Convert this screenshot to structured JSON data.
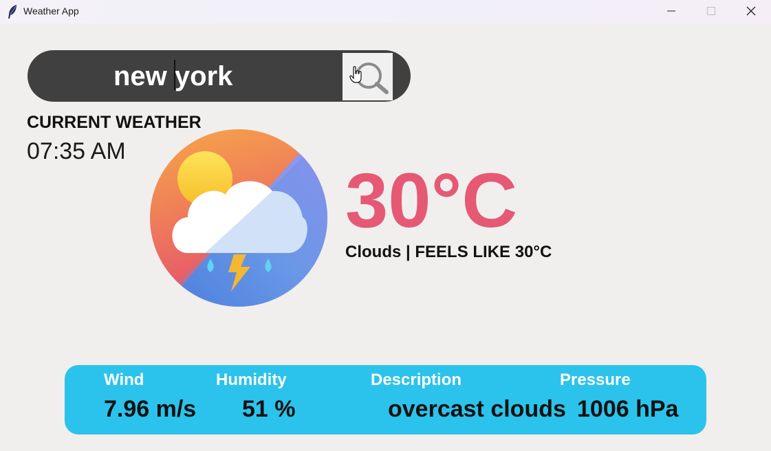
{
  "window": {
    "title": "Weather App",
    "icons": {
      "app": "feather-icon",
      "minimize": "minimize-icon",
      "maximize": "maximize-icon",
      "close": "close-icon"
    }
  },
  "search": {
    "value": "new york",
    "button_icon": "search-icon"
  },
  "current": {
    "label": "CURRENT WEATHER",
    "time": "07:35 AM",
    "icon": "cloud-thunder-rain-icon",
    "temperature": "30°C",
    "condition": "Clouds | FEELS LIKE 30°C"
  },
  "details": {
    "wind": {
      "label": "Wind",
      "value": "7.96 m/s"
    },
    "humidity": {
      "label": "Humidity",
      "value": "51 %"
    },
    "description": {
      "label": "Description",
      "value": "overcast clouds"
    },
    "pressure": {
      "label": "Pressure",
      "value": "1006 hPa"
    }
  },
  "colors": {
    "temperature": "#e55975",
    "panel": "#2bc3eb",
    "search_bar": "#404040"
  }
}
